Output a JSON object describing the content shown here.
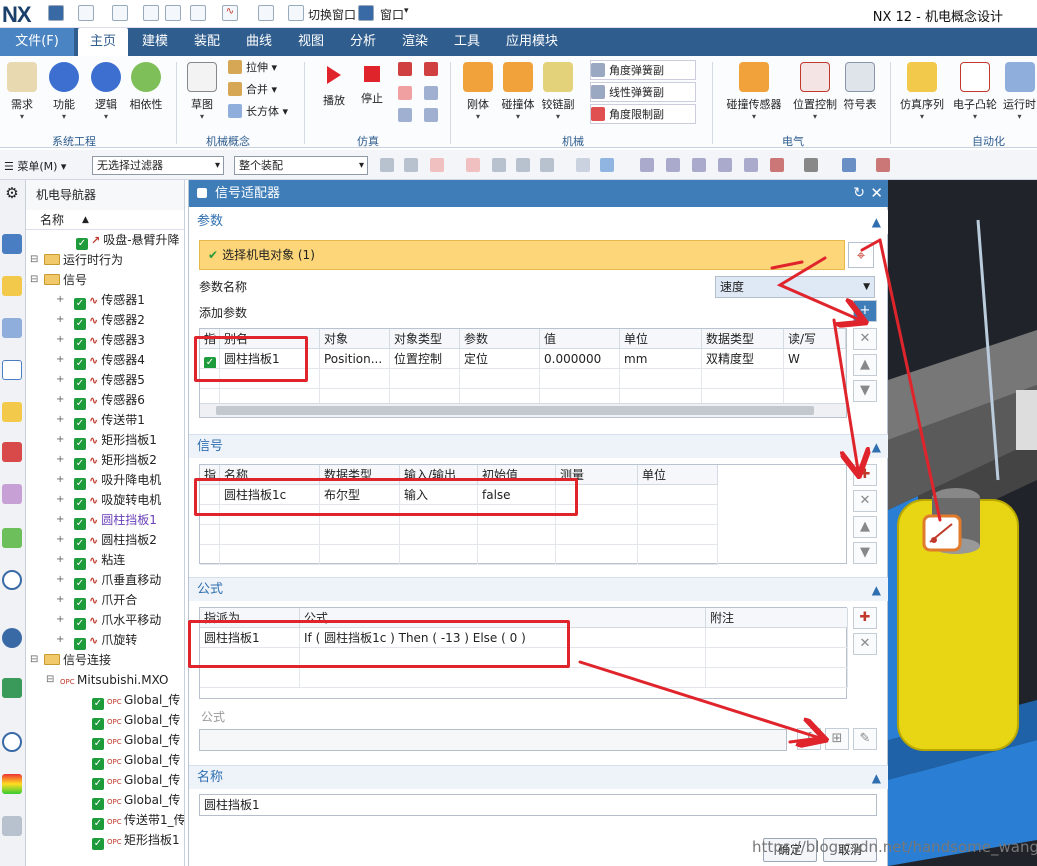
{
  "app": {
    "logo": "NX",
    "title": "NX 12 - 机电概念设计",
    "switch_window": "切换窗口",
    "window_menu": "窗口"
  },
  "menu_tabs": [
    "文件(F)",
    "主页",
    "建模",
    "装配",
    "曲线",
    "视图",
    "分析",
    "渲染",
    "工具",
    "应用模块"
  ],
  "ribbon": {
    "system_engineering": {
      "label": "系统工程",
      "buttons": [
        "需求",
        "功能",
        "逻辑",
        "相依性"
      ]
    },
    "mech_concept": {
      "label": "机械概念",
      "sketch": "草图",
      "small": [
        "拉伸",
        "合并",
        "长方体"
      ]
    },
    "simulation": {
      "label": "仿真",
      "buttons": [
        "播放",
        "停止"
      ]
    },
    "mechanical": {
      "label": "机械",
      "buttons": [
        "刚体",
        "碰撞体",
        "铰链副"
      ],
      "small": [
        "角度弹簧副",
        "线性弹簧副",
        "角度限制副"
      ]
    },
    "electrical": {
      "label": "电气",
      "buttons": [
        "碰撞传感器",
        "位置控制",
        "符号表"
      ]
    },
    "automation": {
      "label": "自动化",
      "buttons": [
        "仿真序列",
        "电子凸轮",
        "运行时"
      ]
    }
  },
  "toolbar2": {
    "menu": "菜单(M)",
    "filter": "无选择过滤器",
    "scope": "整个装配"
  },
  "navigator": {
    "title": "机电导航器",
    "col_name": "名称",
    "items": [
      {
        "label": "吸盘-悬臂升降",
        "type": "check-red"
      },
      {
        "label": "运行时行为",
        "type": "folder"
      },
      {
        "label": "信号",
        "type": "folder"
      },
      {
        "label": "传感器1",
        "type": "signal"
      },
      {
        "label": "传感器2",
        "type": "signal"
      },
      {
        "label": "传感器3",
        "type": "signal"
      },
      {
        "label": "传感器4",
        "type": "signal"
      },
      {
        "label": "传感器5",
        "type": "signal"
      },
      {
        "label": "传感器6",
        "type": "signal"
      },
      {
        "label": "传送带1",
        "type": "signal"
      },
      {
        "label": "矩形挡板1",
        "type": "signal"
      },
      {
        "label": "矩形挡板2",
        "type": "signal"
      },
      {
        "label": "吸升降电机",
        "type": "signal"
      },
      {
        "label": "吸旋转电机",
        "type": "signal"
      },
      {
        "label": "圆柱挡板1",
        "type": "signal",
        "highlight": true
      },
      {
        "label": "圆柱挡板2",
        "type": "signal"
      },
      {
        "label": "粘连",
        "type": "signal"
      },
      {
        "label": "爪垂直移动",
        "type": "signal"
      },
      {
        "label": "爪开合",
        "type": "signal"
      },
      {
        "label": "爪水平移动",
        "type": "signal"
      },
      {
        "label": "爪旋转",
        "type": "signal"
      },
      {
        "label": "信号连接",
        "type": "folder"
      },
      {
        "label": "Mitsubishi.MXO",
        "type": "opc-root"
      },
      {
        "label": "Global_传",
        "type": "opc"
      },
      {
        "label": "Global_传",
        "type": "opc"
      },
      {
        "label": "Global_传",
        "type": "opc"
      },
      {
        "label": "Global_传",
        "type": "opc"
      },
      {
        "label": "Global_传",
        "type": "opc"
      },
      {
        "label": "Global_传",
        "type": "opc"
      },
      {
        "label": "传送带1_传",
        "type": "opc"
      },
      {
        "label": "矩形挡板1",
        "type": "opc"
      }
    ]
  },
  "dialog": {
    "title": "信号适配器",
    "params": {
      "header": "参数",
      "select_object": "选择机电对象 (1)",
      "param_name_label": "参数名称",
      "param_name_value": "速度",
      "add_param": "添加参数",
      "columns": [
        "指",
        "别名",
        "对象",
        "对象类型",
        "参数",
        "值",
        "单位",
        "数据类型",
        "读/写"
      ],
      "rows": [
        [
          "",
          "圆柱挡板1",
          "Position...",
          "位置控制",
          "定位",
          "0.000000",
          "mm",
          "双精度型",
          "W"
        ]
      ]
    },
    "signals": {
      "header": "信号",
      "columns": [
        "指",
        "名称",
        "数据类型",
        "输入/输出",
        "初始值",
        "测量",
        "单位"
      ],
      "rows": [
        [
          "",
          "圆柱挡板1c",
          "布尔型",
          "输入",
          "false",
          "",
          ""
        ]
      ]
    },
    "formula": {
      "header": "公式",
      "columns": [
        "指派为",
        "公式",
        "附注"
      ],
      "rows": [
        [
          "圆柱挡板1",
          "If ( 圆柱挡板1c ) Then ( -13 ) Else ( 0 )",
          ""
        ]
      ],
      "field_label": "公式"
    },
    "name": {
      "header": "名称",
      "value": "圆柱挡板1"
    },
    "ok": "确定",
    "cancel": "取消"
  },
  "watermark": "https://blog.csdn.net/handsome_wang5",
  "colors": {
    "accent": "#2f5d8e",
    "annotation": "#e0242c",
    "select_bar": "#fcd678"
  }
}
